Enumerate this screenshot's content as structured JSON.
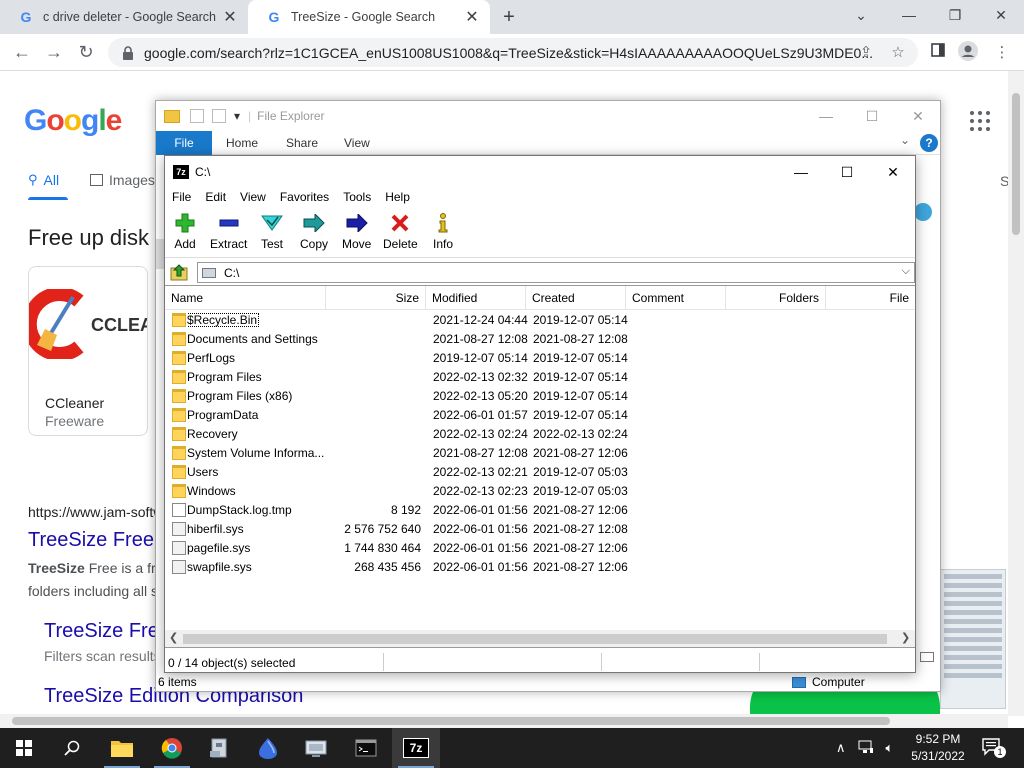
{
  "chrome": {
    "tabs": [
      {
        "title": "c drive deleter - Google Search"
      },
      {
        "title": "TreeSize - Google Search"
      }
    ],
    "url": "google.com/search?rlz=1C1GCEA_enUS1008US1008&q=TreeSize&stick=H4sIAAAAAAAAAOOQUeLSz9U3MDE0..."
  },
  "google": {
    "logo": "Google",
    "nav_all": "All",
    "nav_images": "Images",
    "nav_right": "S",
    "heading": "Free up disk",
    "card": {
      "logo_text": "CCLEA",
      "title": "CCleaner",
      "subtitle": "Freeware"
    },
    "result_url": "https://www.jam-softw",
    "result_title": "TreeSize Free",
    "snippet_bold": "TreeSize",
    "snippet_line1": " Free is a fr",
    "snippet_line2": "folders including all s",
    "sub_link1": "TreeSize Fre",
    "sub_snippet1": "Filters scan results",
    "sub_link2": "TreeSize Edition Comparison"
  },
  "explorer": {
    "title": "File Explorer",
    "tabs": {
      "file": "File",
      "home": "Home",
      "share": "Share",
      "view": "View"
    },
    "status": "6 items",
    "computer": "Computer"
  },
  "sevenzip": {
    "title": "C:\\",
    "menu": [
      "File",
      "Edit",
      "View",
      "Favorites",
      "Tools",
      "Help"
    ],
    "toolbar": {
      "add": "Add",
      "extract": "Extract",
      "test": "Test",
      "copy": "Copy",
      "move": "Move",
      "delete": "Delete",
      "info": "Info"
    },
    "address": "C:\\",
    "columns": {
      "name": "Name",
      "size": "Size",
      "modified": "Modified",
      "created": "Created",
      "comment": "Comment",
      "folders": "Folders",
      "files": "File"
    },
    "rows": [
      {
        "name": "$Recycle.Bin",
        "size": "",
        "modified": "2021-12-24 04:44",
        "created": "2019-12-07 05:14",
        "kind": "folder"
      },
      {
        "name": "Documents and Settings",
        "size": "",
        "modified": "2021-08-27 12:08",
        "created": "2021-08-27 12:08",
        "kind": "folder"
      },
      {
        "name": "PerfLogs",
        "size": "",
        "modified": "2019-12-07 05:14",
        "created": "2019-12-07 05:14",
        "kind": "folder"
      },
      {
        "name": "Program Files",
        "size": "",
        "modified": "2022-02-13 02:32",
        "created": "2019-12-07 05:14",
        "kind": "folder"
      },
      {
        "name": "Program Files (x86)",
        "size": "",
        "modified": "2022-02-13 05:20",
        "created": "2019-12-07 05:14",
        "kind": "folder"
      },
      {
        "name": "ProgramData",
        "size": "",
        "modified": "2022-06-01 01:57",
        "created": "2019-12-07 05:14",
        "kind": "folder"
      },
      {
        "name": "Recovery",
        "size": "",
        "modified": "2022-02-13 02:24",
        "created": "2022-02-13 02:24",
        "kind": "folder"
      },
      {
        "name": "System Volume Informa...",
        "size": "",
        "modified": "2021-08-27 12:08",
        "created": "2021-08-27 12:06",
        "kind": "folder"
      },
      {
        "name": "Users",
        "size": "",
        "modified": "2022-02-13 02:21",
        "created": "2019-12-07 05:03",
        "kind": "folder"
      },
      {
        "name": "Windows",
        "size": "",
        "modified": "2022-02-13 02:23",
        "created": "2019-12-07 05:03",
        "kind": "folder"
      },
      {
        "name": "DumpStack.log.tmp",
        "size": "8 192",
        "modified": "2022-06-01 01:56",
        "created": "2021-08-27 12:06",
        "kind": "file"
      },
      {
        "name": "hiberfil.sys",
        "size": "2 576 752 640",
        "modified": "2022-06-01 01:56",
        "created": "2021-08-27 12:08",
        "kind": "sys"
      },
      {
        "name": "pagefile.sys",
        "size": "1 744 830 464",
        "modified": "2022-06-01 01:56",
        "created": "2021-08-27 12:06",
        "kind": "sys"
      },
      {
        "name": "swapfile.sys",
        "size": "268 435 456",
        "modified": "2022-06-01 01:56",
        "created": "2021-08-27 12:06",
        "kind": "sys"
      }
    ],
    "status": "0 / 14 object(s) selected"
  },
  "taskbar": {
    "time": "9:52 PM",
    "date": "5/31/2022",
    "notification_count": "1",
    "active_app_label": "7z"
  },
  "colors": {
    "google_blue": "#4285f4",
    "google_red": "#ea4335",
    "google_yellow": "#fbbc05",
    "google_green": "#34a853",
    "link": "#1a0dab",
    "explorer_accent": "#1979ca",
    "taskbar": "#1f1f1f"
  }
}
